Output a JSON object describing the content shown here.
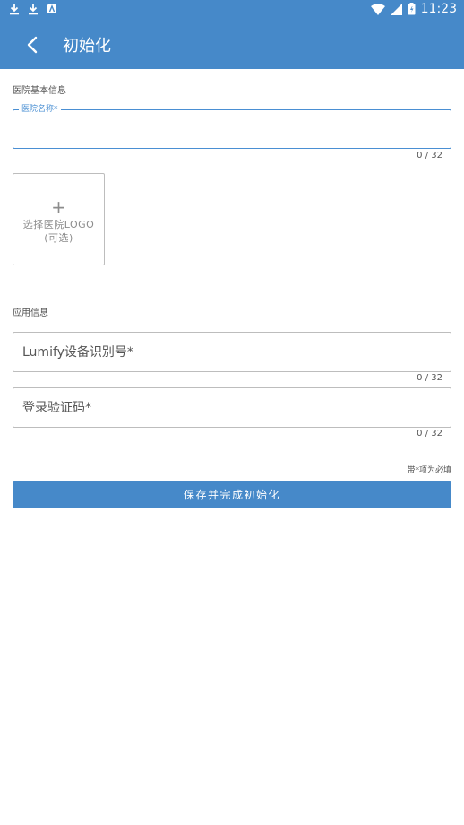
{
  "statusbar": {
    "left_icons": [
      "download-icon",
      "download-icon",
      "app-icon"
    ],
    "right_icons": [
      "wifi-icon",
      "signal-icon",
      "battery-icon"
    ],
    "time": "11:23"
  },
  "appbar": {
    "back_icon": "chevron-left-icon",
    "title": "初始化"
  },
  "hospital_section": {
    "title": "医院基本信息",
    "name_field": {
      "label": "医院名称*",
      "value": "",
      "counter": "0 / 32"
    },
    "logo": {
      "plus": "+",
      "line1": "选择医院LOGO",
      "line2": "(可选)"
    }
  },
  "app_section": {
    "title": "应用信息",
    "device_id_field": {
      "placeholder": "Lumify设备识别号*",
      "value": "",
      "counter": "0 / 32"
    },
    "login_code_field": {
      "placeholder": "登录验证码*",
      "value": "",
      "counter": "0 / 32"
    }
  },
  "footer": {
    "required_note": "带*项为必填",
    "save_label": "保存并完成初始化"
  },
  "colors": {
    "primary": "#4689c9",
    "focus": "#4a8fd3",
    "border": "#bdbdbd"
  }
}
